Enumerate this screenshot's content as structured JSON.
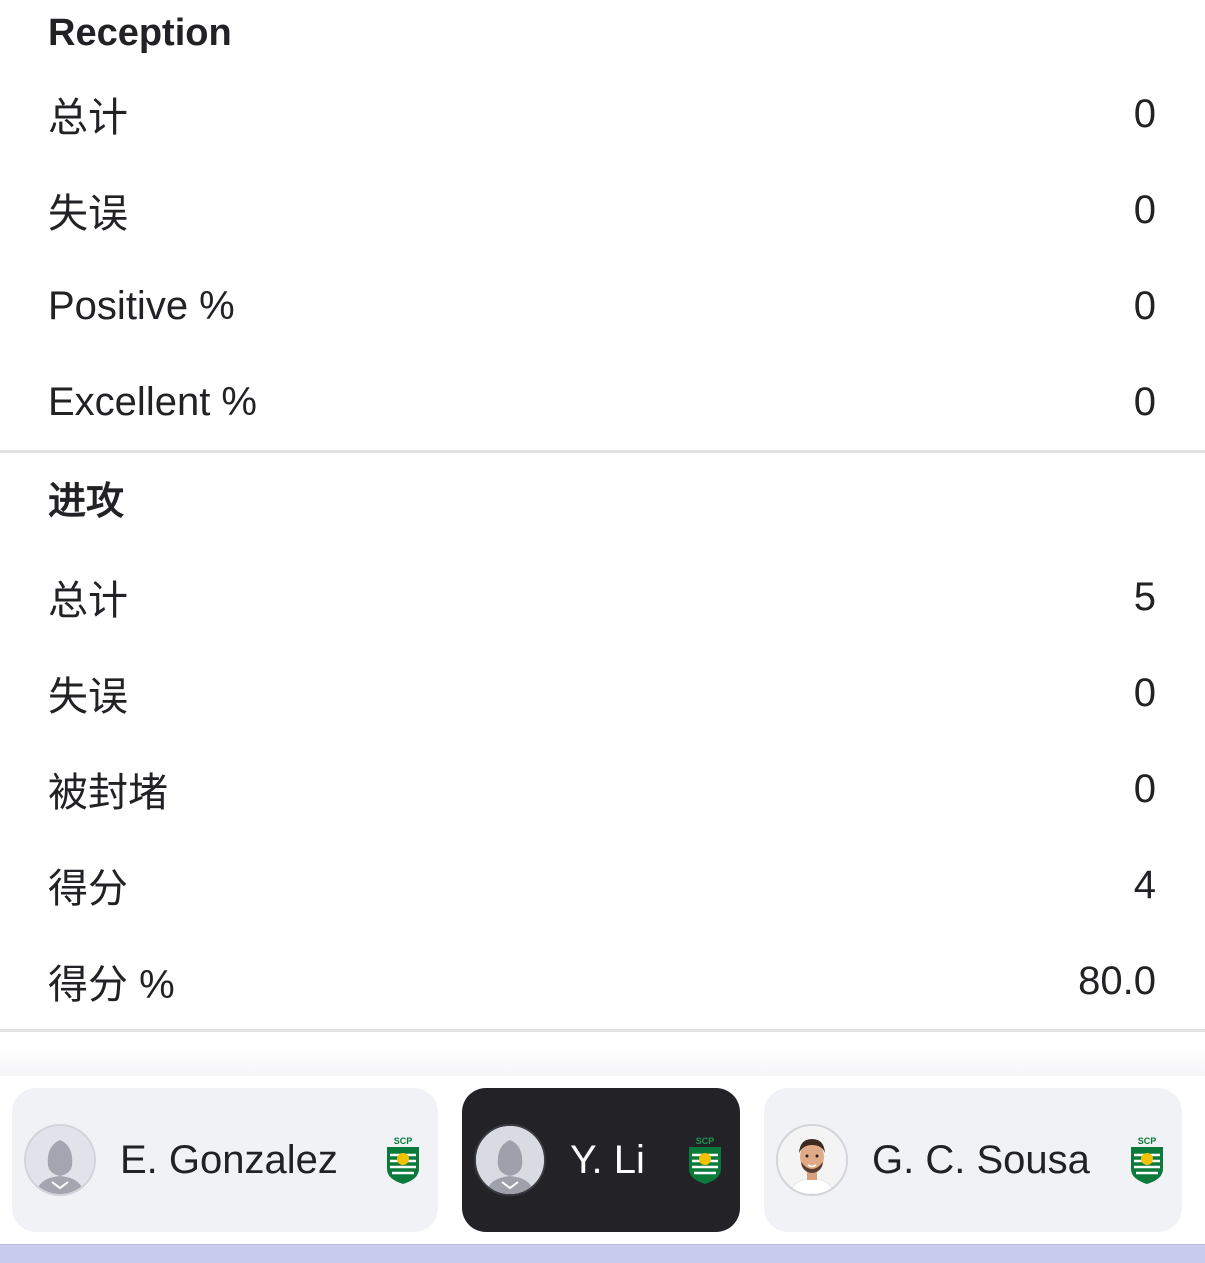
{
  "sections": [
    {
      "title": "Reception",
      "rows": [
        {
          "label": "总计",
          "value": "0"
        },
        {
          "label": "失误",
          "value": "0"
        },
        {
          "label": "Positive %",
          "value": "0"
        },
        {
          "label": "Excellent %",
          "value": "0"
        }
      ]
    },
    {
      "title": "进攻",
      "rows": [
        {
          "label": "总计",
          "value": "5"
        },
        {
          "label": "失误",
          "value": "0"
        },
        {
          "label": "被封堵",
          "value": "0"
        },
        {
          "label": "得分",
          "value": "4"
        },
        {
          "label": "得分 %",
          "value": "80.0"
        }
      ]
    }
  ],
  "players": [
    {
      "name": "E. Gonzalez",
      "avatar": "placeholder-avatar-icon",
      "team_badge": "sporting-cp-badge-icon",
      "active": false
    },
    {
      "name": "Y. Li",
      "avatar": "placeholder-avatar-icon",
      "team_badge": "sporting-cp-badge-icon",
      "active": true
    },
    {
      "name": "G. C. Sousa",
      "avatar": "player-photo",
      "team_badge": "sporting-cp-badge-icon",
      "active": false
    }
  ],
  "colors": {
    "active_chip": "#232327",
    "chip": "#f1f2f6",
    "divider": "#e3e3e6",
    "badge_green": "#0b7a3b",
    "bottom_strip": "#c9cbee"
  }
}
